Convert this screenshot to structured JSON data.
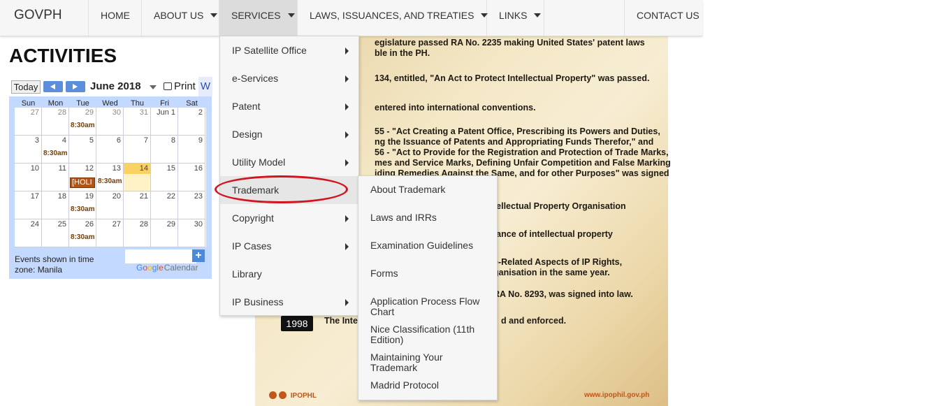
{
  "nav": {
    "brand": "GOVPH",
    "items": [
      {
        "label": "HOME"
      },
      {
        "label": "ABOUT US"
      },
      {
        "label": "SERVICES"
      },
      {
        "label": "LAWS, ISSUANCES, AND TREATIES"
      },
      {
        "label": "LINKS"
      },
      {
        "label": "CONTACT US"
      }
    ]
  },
  "page_title": "ACTIVITIES",
  "calendar": {
    "today_label": "Today",
    "month_title": "June 2018",
    "print_label": "Print",
    "week_label": "W",
    "days_of_week": [
      "Sun",
      "Mon",
      "Tue",
      "Wed",
      "Thu",
      "Fri",
      "Sat"
    ],
    "weeks": [
      [
        "27",
        "28",
        "29",
        "30",
        "31",
        "Jun 1",
        "2"
      ],
      [
        "3",
        "4",
        "5",
        "6",
        "7",
        "8",
        "9"
      ],
      [
        "10",
        "11",
        "12",
        "13",
        "14",
        "15",
        "16"
      ],
      [
        "17",
        "18",
        "19",
        "20",
        "21",
        "22",
        "23"
      ],
      [
        "24",
        "25",
        "26",
        "27",
        "28",
        "29",
        "30"
      ]
    ],
    "event_time": "8:30am",
    "holiday_label": "[HOLI",
    "timezone_note": "Events shown in time zone: Manila",
    "google_calendar": "Google Calendar",
    "add_label": "+"
  },
  "services_menu": [
    {
      "label": "IP Satellite Office",
      "has_sub": true
    },
    {
      "label": "e-Services",
      "has_sub": true
    },
    {
      "label": "Patent",
      "has_sub": true
    },
    {
      "label": "Design",
      "has_sub": true
    },
    {
      "label": "Utility Model",
      "has_sub": true
    },
    {
      "label": "Trademark",
      "has_sub": false
    },
    {
      "label": "Copyright",
      "has_sub": true
    },
    {
      "label": "IP Cases",
      "has_sub": true
    },
    {
      "label": "Library",
      "has_sub": false
    },
    {
      "label": "IP Business",
      "has_sub": true
    }
  ],
  "trademark_menu": [
    {
      "label": "About Trademark"
    },
    {
      "label": "Laws and IRRs"
    },
    {
      "label": "Examination Guidelines"
    },
    {
      "label": "Forms"
    },
    {
      "label": "Application Process Flow Chart"
    },
    {
      "label": "Nice Classification (11th Edition)"
    },
    {
      "label": "Maintaining Your Trademark"
    },
    {
      "label": "Madrid Protocol"
    }
  ],
  "poster": {
    "lines": [
      "egislature passed RA No. 2235 making United States' patent laws",
      "ble in the PH.",
      "134, entitled,  \"An Act to Protect Intellectual Property\" was passed.",
      "entered into international conventions.",
      "55 - \"Act Creating a Patent Office, Prescribing its Powers and Duties,",
      "ng the Issuance of Patents and Appropriating Funds Therefor,\" and",
      "56 - \"Act to Provide for the Registration and Protection of Trade Marks,",
      "mes and Service Marks, Defining Unfair Competition and False Marking",
      "iding Remedies Against the Same, and for other Purposes\" was signed",
      "tellectual Property Organisation",
      "tance of intellectual property",
      "e-Related Aspects of IP Rights,",
      "ganisation in the same year.",
      "RA No. 8293, was signed into law.",
      "The Inte",
      "d and enforced."
    ],
    "year": "1998",
    "footer_left": "IPOPHL",
    "footer_right": "www.ipophil.gov.ph"
  }
}
